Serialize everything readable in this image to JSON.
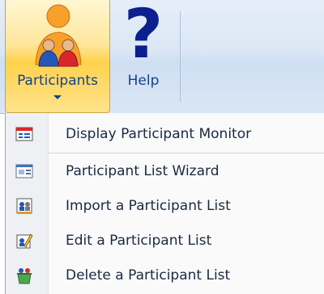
{
  "ribbon": {
    "participants_label": "Participants",
    "help_label": "Help",
    "help_glyph": "?"
  },
  "menu": {
    "items": [
      {
        "label": "Display Participant Monitor",
        "icon": "monitor-icon"
      },
      {
        "label": "Participant List Wizard",
        "icon": "wizard-icon"
      },
      {
        "label": "Import a Participant List",
        "icon": "import-icon"
      },
      {
        "label": "Edit a Participant List",
        "icon": "edit-icon"
      },
      {
        "label": "Delete a Participant List",
        "icon": "delete-icon"
      }
    ]
  },
  "colors": {
    "accent": "#15428b",
    "hover": "#ffd24d",
    "menu_text": "#1b2a40"
  }
}
